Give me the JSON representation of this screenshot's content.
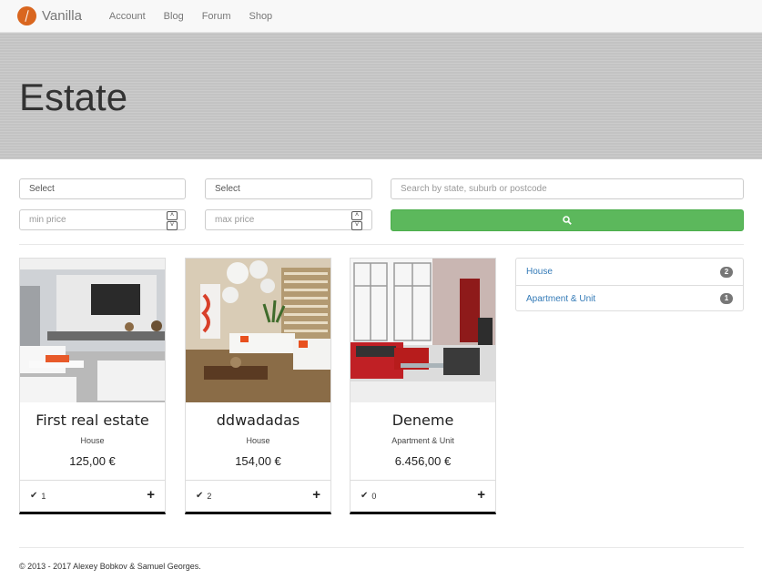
{
  "nav": {
    "brand": "Vanilla",
    "links": [
      "Account",
      "Blog",
      "Forum",
      "Shop"
    ]
  },
  "hero": {
    "title": "Estate"
  },
  "filters": {
    "select1": "Select",
    "select2": "Select",
    "search_placeholder": "Search by state, suburb or postcode",
    "min_price_placeholder": "min price",
    "max_price_placeholder": "max price"
  },
  "listings": [
    {
      "title": "First real estate",
      "type": "House",
      "price": "125,00 €",
      "likes": "1"
    },
    {
      "title": "ddwadadas",
      "type": "House",
      "price": "154,00 €",
      "likes": "2"
    },
    {
      "title": "Deneme",
      "type": "Apartment & Unit",
      "price": "6.456,00 €",
      "likes": "0"
    }
  ],
  "categories": [
    {
      "label": "House",
      "count": "2"
    },
    {
      "label": "Apartment & Unit",
      "count": "1"
    }
  ],
  "footer": {
    "text": "© 2013 - 2017 Alexey Bobkov & Samuel Georges."
  },
  "colors": {
    "accent": "#5cb85c",
    "link": "#337ab7",
    "brand": "#d9661f"
  },
  "icons": {
    "search": "search-icon",
    "like": "check-icon",
    "add": "plus-icon"
  }
}
